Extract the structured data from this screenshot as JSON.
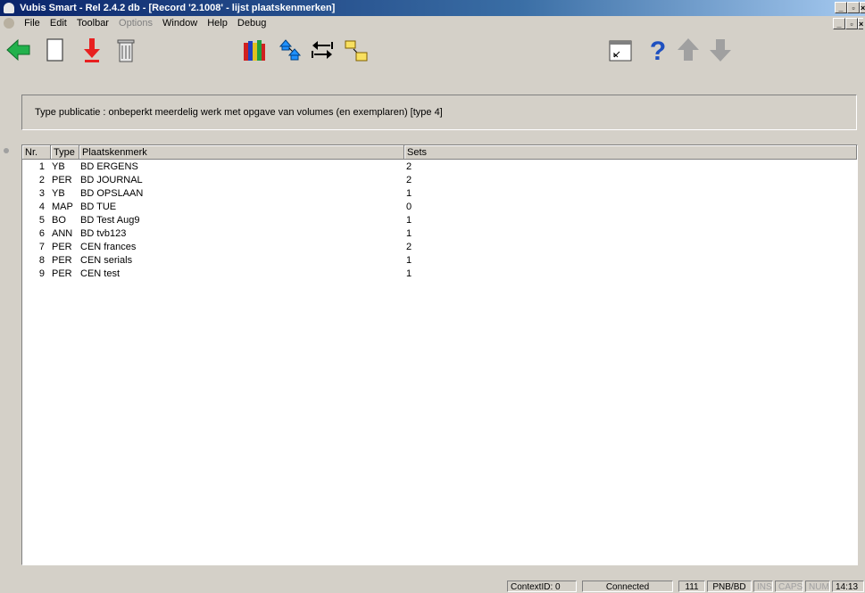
{
  "window": {
    "title": "Vubis Smart - Rel 2.4.2 db - [Record '2.1008' - lijst plaatskenmerken]"
  },
  "menu": [
    {
      "label": "File",
      "disabled": false
    },
    {
      "label": "Edit",
      "disabled": false
    },
    {
      "label": "Toolbar",
      "disabled": false
    },
    {
      "label": "Options",
      "disabled": true
    },
    {
      "label": "Window",
      "disabled": false
    },
    {
      "label": "Help",
      "disabled": false
    },
    {
      "label": "Debug",
      "disabled": false
    }
  ],
  "toolbar_icons": [
    "back-arrow-icon",
    "new-document-icon",
    "download-arrow-icon",
    "trash-icon",
    "books-icon",
    "move-up-icon",
    "swap-arrows-icon",
    "folder-move-icon",
    "form-icon",
    "help-icon",
    "up-arrow-icon",
    "down-arrow-icon"
  ],
  "info": {
    "text": "Type publicatie : onbeperkt meerdelig werk met opgave van volumes (en exemplaren) [type 4]"
  },
  "table": {
    "columns": [
      "Nr.",
      "Type",
      "Plaatskenmerk",
      "Sets"
    ],
    "rows": [
      {
        "nr": "1",
        "type": "YB",
        "plaats": "BD ERGENS",
        "sets": "2"
      },
      {
        "nr": "2",
        "type": "PER",
        "plaats": "BD JOURNAL",
        "sets": "2"
      },
      {
        "nr": "3",
        "type": "YB",
        "plaats": "BD OPSLAAN",
        "sets": "1"
      },
      {
        "nr": "4",
        "type": "MAP",
        "plaats": "BD TUE",
        "sets": "0"
      },
      {
        "nr": "5",
        "type": "BO",
        "plaats": "BD Test Aug9",
        "sets": "1"
      },
      {
        "nr": "6",
        "type": "ANN",
        "plaats": "BD tvb123",
        "sets": "1"
      },
      {
        "nr": "7",
        "type": "PER",
        "plaats": "CEN frances",
        "sets": "2"
      },
      {
        "nr": "8",
        "type": "PER",
        "plaats": "CEN serials",
        "sets": "1"
      },
      {
        "nr": "9",
        "type": "PER",
        "plaats": "CEN test",
        "sets": "1"
      }
    ]
  },
  "status": {
    "context": "ContextID: 0",
    "connection": "Connected",
    "count": "111",
    "location": "PNB/BD",
    "ins": "INS",
    "caps": "CAPS",
    "num": "NUM",
    "time": "14:13"
  },
  "colors": {
    "title_start": "#0a246a",
    "title_end": "#a6caf0",
    "face": "#d4d0c8"
  }
}
